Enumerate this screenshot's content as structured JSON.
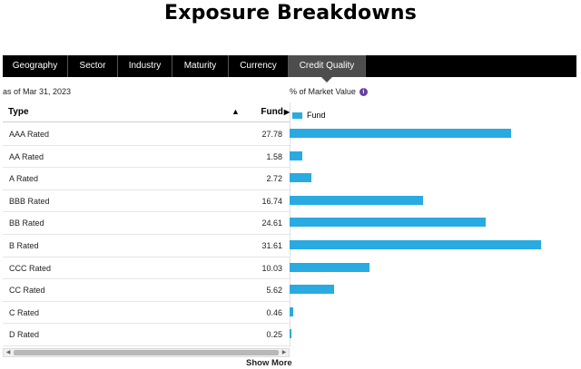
{
  "page": {
    "title": "Exposure Breakdowns"
  },
  "tabs": [
    {
      "label": "Geography",
      "active": false
    },
    {
      "label": "Sector",
      "active": false
    },
    {
      "label": "Industry",
      "active": false
    },
    {
      "label": "Maturity",
      "active": false
    },
    {
      "label": "Currency",
      "active": false
    },
    {
      "label": "Credit Quality",
      "active": true
    }
  ],
  "as_of": "as of Mar 31, 2023",
  "metric_label": "% of Market Value",
  "info_icon_glyph": "i",
  "table": {
    "col_type": "Type",
    "col_fund": "Fund",
    "sort_glyph": "▲",
    "fund_glyph": "▶"
  },
  "legend": {
    "name": "Fund",
    "color": "#29aae1"
  },
  "scroll": {
    "left": "◀",
    "right": "▶"
  },
  "show_more": "Show More",
  "chart_data": {
    "type": "bar",
    "orientation": "horizontal",
    "categories": [
      "AAA Rated",
      "AA Rated",
      "A Rated",
      "BBB Rated",
      "BB Rated",
      "B Rated",
      "CCC Rated",
      "CC Rated",
      "C Rated",
      "D Rated"
    ],
    "series": [
      {
        "name": "Fund",
        "values": [
          27.78,
          1.58,
          2.72,
          16.74,
          24.61,
          31.61,
          10.03,
          5.62,
          0.46,
          0.25
        ],
        "color": "#29aae1"
      }
    ],
    "value_labels": [
      "27.78",
      "1.58",
      "2.72",
      "16.74",
      "24.61",
      "31.61",
      "10.03",
      "5.62",
      "0.46",
      "0.25"
    ],
    "xlim": [
      0,
      36
    ],
    "ylabel": "% of Market Value",
    "legend": "top-left",
    "grid": false
  }
}
